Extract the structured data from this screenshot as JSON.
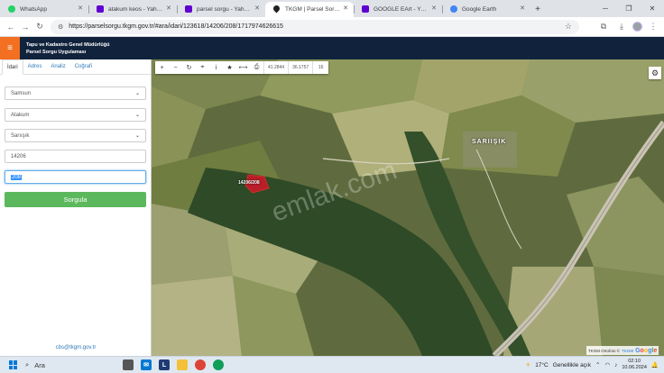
{
  "browser": {
    "tabs": [
      {
        "label": "WhatsApp",
        "icon": "whatsapp-icon",
        "color": "#25d366",
        "active": false
      },
      {
        "label": "atakum keos - Yahoo Türkiye",
        "icon": "yahoo-icon",
        "color": "#6001d2",
        "active": false
      },
      {
        "label": "parsel sorgu - Yahoo Türkiye",
        "icon": "yahoo-icon",
        "color": "#6001d2",
        "active": false
      },
      {
        "label": "TKGM | Parsel Sorgu Uygulaması",
        "icon": "map-pin-icon",
        "color": "#202124",
        "active": true
      },
      {
        "label": "GOOGLE EArt - Yahoo Türkiye",
        "icon": "yahoo-icon",
        "color": "#6001d2",
        "active": false
      },
      {
        "label": "Google Earth",
        "icon": "google-earth-icon",
        "color": "#4285f4",
        "active": false
      }
    ],
    "url": "https://parselsorgu.tkgm.gov.tr/#ara/idari/123618/14206/208/1717974626615"
  },
  "app": {
    "title_line1": "Tapu ve Kadastro Genel Müdürlüğü",
    "title_line2": "Parsel Sorgu Uygulaması",
    "accent": "#f36f21",
    "header_bg": "#11233c"
  },
  "panel": {
    "tabs": [
      "İdari",
      "Adres",
      "Analiz",
      "Coğrafi"
    ],
    "active_tab": "İdari",
    "il": "Samsun",
    "ilce": "Atakum",
    "mahalle": "Sarıışık",
    "ada": "14206",
    "parsel": "208",
    "submit_label": "Sorgula",
    "submit_color": "#5cb85c",
    "email": "cbs@tkgm.gov.tr"
  },
  "map": {
    "coord_x": "41.2844",
    "coord_y": "36.1757",
    "zoom": "16",
    "place_label": "SARIIŞIK",
    "parcel_label": "14206/208",
    "watermark": "emlak.com",
    "attribution": "TKGM Ortofoto ©",
    "attribution_brand": "TKGM",
    "google_logo": [
      "G",
      "o",
      "o",
      "g",
      "l",
      "e"
    ]
  },
  "taskbar": {
    "search_label": "Ara",
    "temperature": "17°C",
    "weather": "Genellikle açık",
    "time": "02:10",
    "date": "10.06.2024"
  }
}
